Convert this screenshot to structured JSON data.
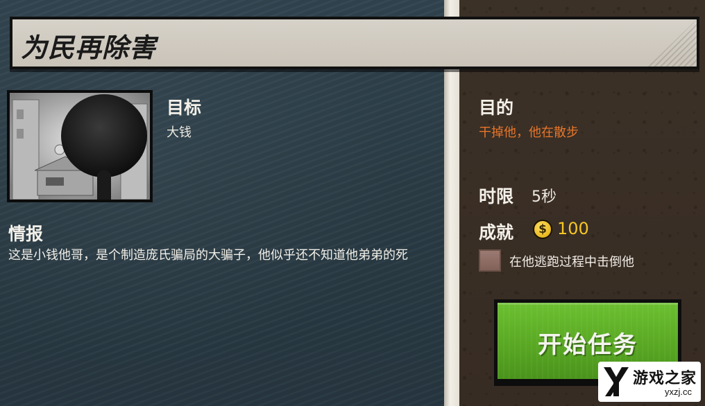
{
  "mission": {
    "title": "为民再除害"
  },
  "target": {
    "label": "目标",
    "name": "大钱"
  },
  "intel": {
    "label": "情报",
    "text": "这是小钱他哥，是个制造庞氏骗局的大骗子，他似乎还不知道他弟弟的死"
  },
  "purpose": {
    "label": "目的",
    "text": "干掉他，他在散步"
  },
  "time_limit": {
    "label": "时限",
    "value": "5秒"
  },
  "achievement": {
    "label": "成就",
    "coin_symbol": "$",
    "reward": "100",
    "bonus_text": "在他逃跑过程中击倒他",
    "bonus_checked": false
  },
  "start_button": {
    "label": "开始任务"
  },
  "watermark_logo": {
    "name": "游戏之家",
    "url": "yxzj.cc"
  },
  "colors": {
    "accent_orange": "#e8762a",
    "coin_gold": "#f5c625",
    "button_green": "#59a823"
  }
}
